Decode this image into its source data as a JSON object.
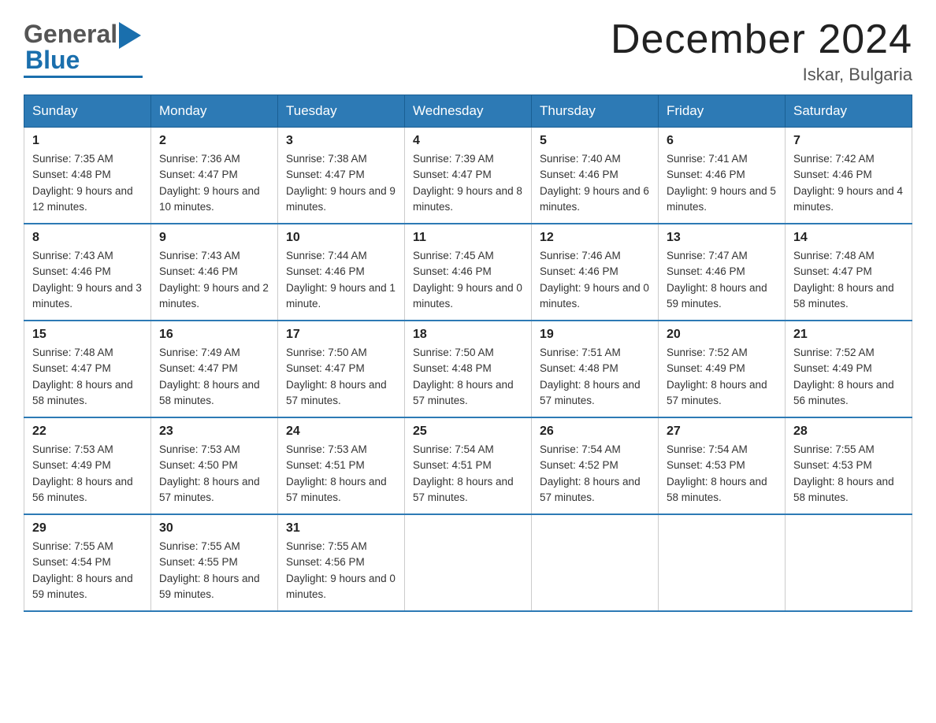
{
  "logo": {
    "general": "General",
    "blue": "Blue"
  },
  "title": "December 2024",
  "location": "Iskar, Bulgaria",
  "days_of_week": [
    "Sunday",
    "Monday",
    "Tuesday",
    "Wednesday",
    "Thursday",
    "Friday",
    "Saturday"
  ],
  "weeks": [
    [
      {
        "day": "1",
        "sunrise": "Sunrise: 7:35 AM",
        "sunset": "Sunset: 4:48 PM",
        "daylight": "Daylight: 9 hours and 12 minutes."
      },
      {
        "day": "2",
        "sunrise": "Sunrise: 7:36 AM",
        "sunset": "Sunset: 4:47 PM",
        "daylight": "Daylight: 9 hours and 10 minutes."
      },
      {
        "day": "3",
        "sunrise": "Sunrise: 7:38 AM",
        "sunset": "Sunset: 4:47 PM",
        "daylight": "Daylight: 9 hours and 9 minutes."
      },
      {
        "day": "4",
        "sunrise": "Sunrise: 7:39 AM",
        "sunset": "Sunset: 4:47 PM",
        "daylight": "Daylight: 9 hours and 8 minutes."
      },
      {
        "day": "5",
        "sunrise": "Sunrise: 7:40 AM",
        "sunset": "Sunset: 4:46 PM",
        "daylight": "Daylight: 9 hours and 6 minutes."
      },
      {
        "day": "6",
        "sunrise": "Sunrise: 7:41 AM",
        "sunset": "Sunset: 4:46 PM",
        "daylight": "Daylight: 9 hours and 5 minutes."
      },
      {
        "day": "7",
        "sunrise": "Sunrise: 7:42 AM",
        "sunset": "Sunset: 4:46 PM",
        "daylight": "Daylight: 9 hours and 4 minutes."
      }
    ],
    [
      {
        "day": "8",
        "sunrise": "Sunrise: 7:43 AM",
        "sunset": "Sunset: 4:46 PM",
        "daylight": "Daylight: 9 hours and 3 minutes."
      },
      {
        "day": "9",
        "sunrise": "Sunrise: 7:43 AM",
        "sunset": "Sunset: 4:46 PM",
        "daylight": "Daylight: 9 hours and 2 minutes."
      },
      {
        "day": "10",
        "sunrise": "Sunrise: 7:44 AM",
        "sunset": "Sunset: 4:46 PM",
        "daylight": "Daylight: 9 hours and 1 minute."
      },
      {
        "day": "11",
        "sunrise": "Sunrise: 7:45 AM",
        "sunset": "Sunset: 4:46 PM",
        "daylight": "Daylight: 9 hours and 0 minutes."
      },
      {
        "day": "12",
        "sunrise": "Sunrise: 7:46 AM",
        "sunset": "Sunset: 4:46 PM",
        "daylight": "Daylight: 9 hours and 0 minutes."
      },
      {
        "day": "13",
        "sunrise": "Sunrise: 7:47 AM",
        "sunset": "Sunset: 4:46 PM",
        "daylight": "Daylight: 8 hours and 59 minutes."
      },
      {
        "day": "14",
        "sunrise": "Sunrise: 7:48 AM",
        "sunset": "Sunset: 4:47 PM",
        "daylight": "Daylight: 8 hours and 58 minutes."
      }
    ],
    [
      {
        "day": "15",
        "sunrise": "Sunrise: 7:48 AM",
        "sunset": "Sunset: 4:47 PM",
        "daylight": "Daylight: 8 hours and 58 minutes."
      },
      {
        "day": "16",
        "sunrise": "Sunrise: 7:49 AM",
        "sunset": "Sunset: 4:47 PM",
        "daylight": "Daylight: 8 hours and 58 minutes."
      },
      {
        "day": "17",
        "sunrise": "Sunrise: 7:50 AM",
        "sunset": "Sunset: 4:47 PM",
        "daylight": "Daylight: 8 hours and 57 minutes."
      },
      {
        "day": "18",
        "sunrise": "Sunrise: 7:50 AM",
        "sunset": "Sunset: 4:48 PM",
        "daylight": "Daylight: 8 hours and 57 minutes."
      },
      {
        "day": "19",
        "sunrise": "Sunrise: 7:51 AM",
        "sunset": "Sunset: 4:48 PM",
        "daylight": "Daylight: 8 hours and 57 minutes."
      },
      {
        "day": "20",
        "sunrise": "Sunrise: 7:52 AM",
        "sunset": "Sunset: 4:49 PM",
        "daylight": "Daylight: 8 hours and 57 minutes."
      },
      {
        "day": "21",
        "sunrise": "Sunrise: 7:52 AM",
        "sunset": "Sunset: 4:49 PM",
        "daylight": "Daylight: 8 hours and 56 minutes."
      }
    ],
    [
      {
        "day": "22",
        "sunrise": "Sunrise: 7:53 AM",
        "sunset": "Sunset: 4:49 PM",
        "daylight": "Daylight: 8 hours and 56 minutes."
      },
      {
        "day": "23",
        "sunrise": "Sunrise: 7:53 AM",
        "sunset": "Sunset: 4:50 PM",
        "daylight": "Daylight: 8 hours and 57 minutes."
      },
      {
        "day": "24",
        "sunrise": "Sunrise: 7:53 AM",
        "sunset": "Sunset: 4:51 PM",
        "daylight": "Daylight: 8 hours and 57 minutes."
      },
      {
        "day": "25",
        "sunrise": "Sunrise: 7:54 AM",
        "sunset": "Sunset: 4:51 PM",
        "daylight": "Daylight: 8 hours and 57 minutes."
      },
      {
        "day": "26",
        "sunrise": "Sunrise: 7:54 AM",
        "sunset": "Sunset: 4:52 PM",
        "daylight": "Daylight: 8 hours and 57 minutes."
      },
      {
        "day": "27",
        "sunrise": "Sunrise: 7:54 AM",
        "sunset": "Sunset: 4:53 PM",
        "daylight": "Daylight: 8 hours and 58 minutes."
      },
      {
        "day": "28",
        "sunrise": "Sunrise: 7:55 AM",
        "sunset": "Sunset: 4:53 PM",
        "daylight": "Daylight: 8 hours and 58 minutes."
      }
    ],
    [
      {
        "day": "29",
        "sunrise": "Sunrise: 7:55 AM",
        "sunset": "Sunset: 4:54 PM",
        "daylight": "Daylight: 8 hours and 59 minutes."
      },
      {
        "day": "30",
        "sunrise": "Sunrise: 7:55 AM",
        "sunset": "Sunset: 4:55 PM",
        "daylight": "Daylight: 8 hours and 59 minutes."
      },
      {
        "day": "31",
        "sunrise": "Sunrise: 7:55 AM",
        "sunset": "Sunset: 4:56 PM",
        "daylight": "Daylight: 9 hours and 0 minutes."
      },
      null,
      null,
      null,
      null
    ]
  ]
}
